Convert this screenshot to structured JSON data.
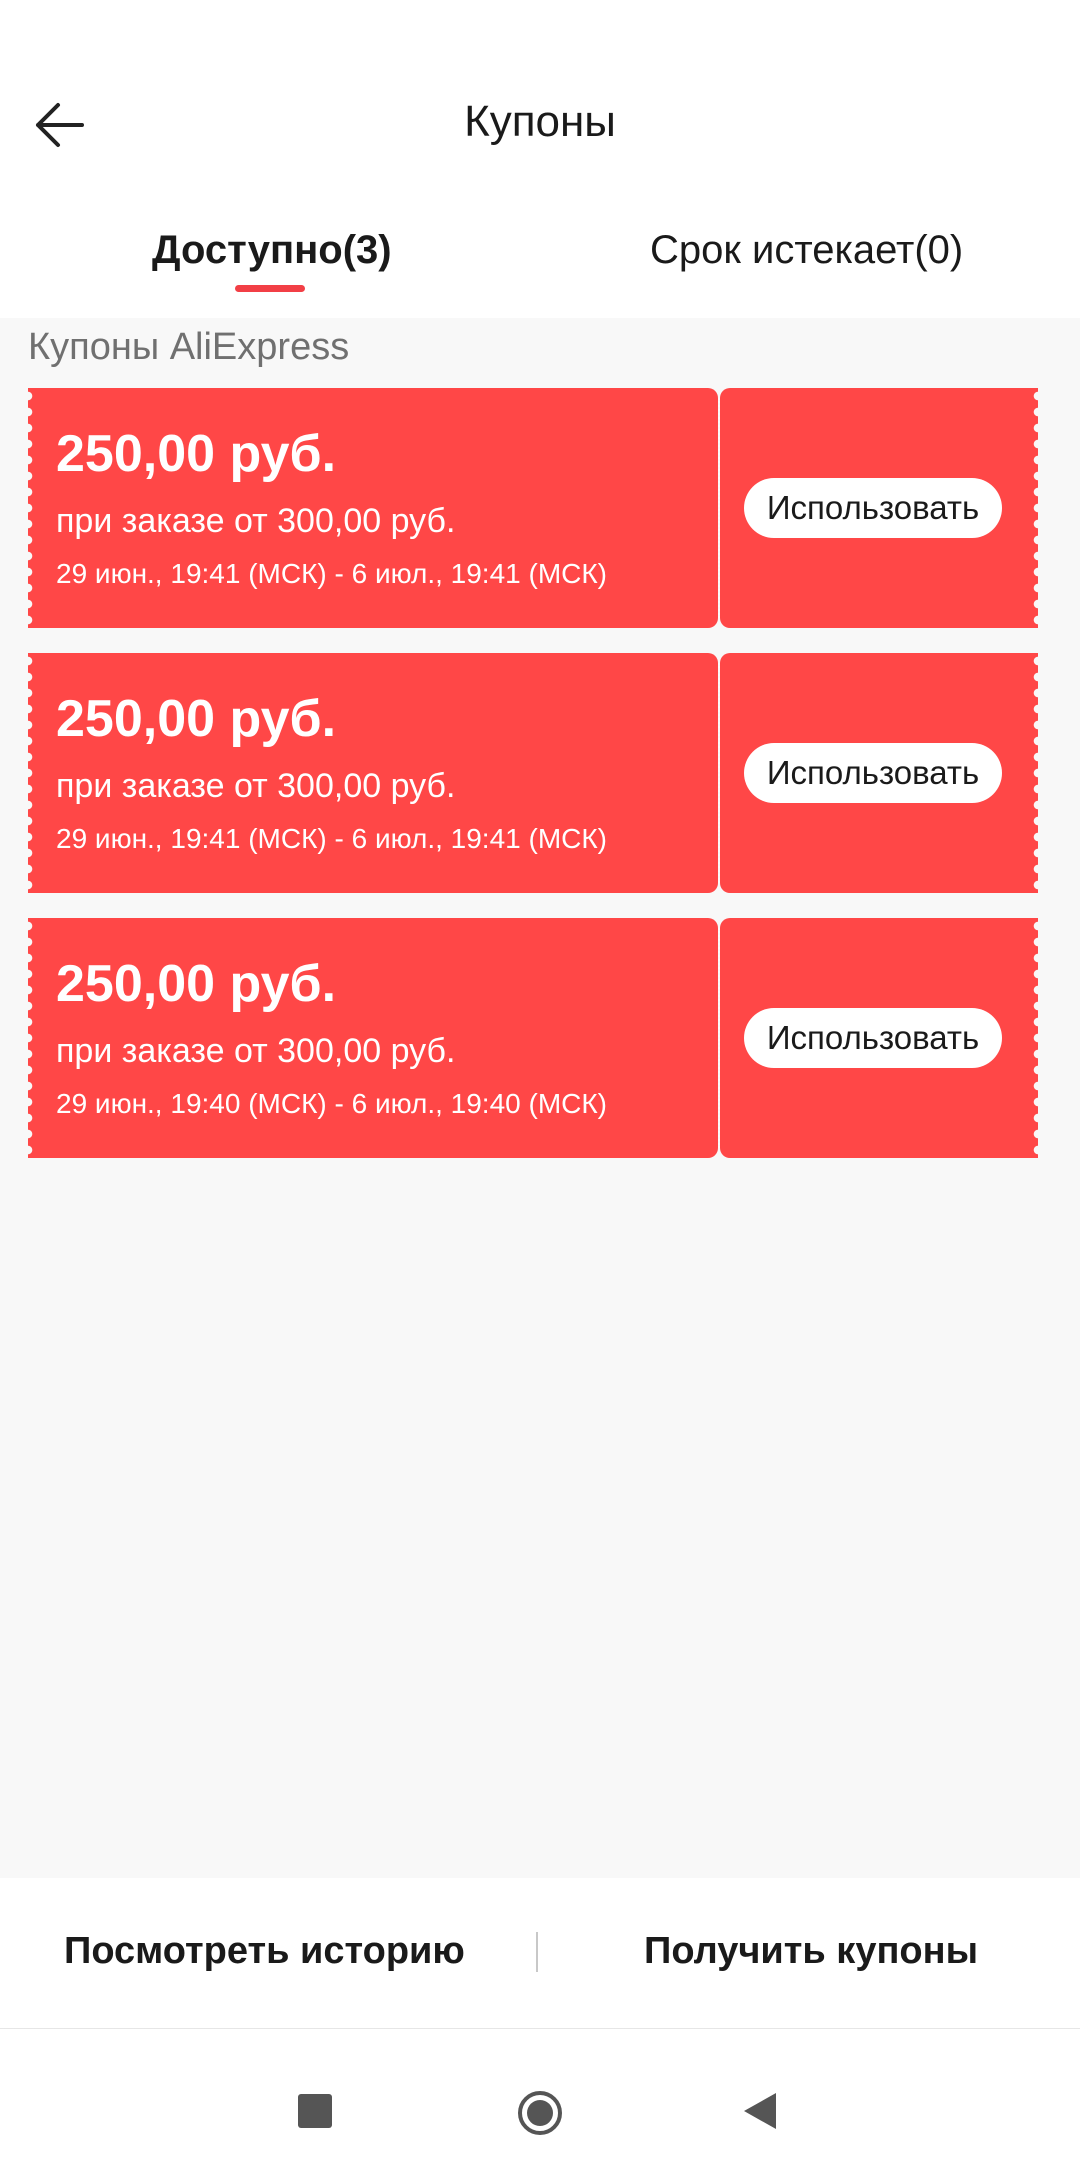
{
  "header": {
    "title": "Купоны"
  },
  "tabs": [
    {
      "label": "Доступно(3)",
      "active": true
    },
    {
      "label": "Срок истекает(0)",
      "active": false
    }
  ],
  "section": {
    "title": "Купоны AliExpress"
  },
  "coupons": [
    {
      "amount": "250,00 руб.",
      "condition": "при заказе от 300,00 руб.",
      "period": "29 июн., 19:41 (МСК) - 6 июл., 19:41 (МСК)",
      "button": "Использовать"
    },
    {
      "amount": "250,00 руб.",
      "condition": "при заказе от 300,00 руб.",
      "period": "29 июн., 19:41 (МСК) - 6 июл., 19:41 (МСК)",
      "button": "Использовать"
    },
    {
      "amount": "250,00 руб.",
      "condition": "при заказе от 300,00 руб.",
      "period": "29 июн., 19:40 (МСК) - 6 июл., 19:40 (МСК)",
      "button": "Использовать"
    }
  ],
  "footer": {
    "history_label": "Посмотреть историю",
    "get_coupons_label": "Получить купоны"
  },
  "colors": {
    "coupon": "#ff4747",
    "accent": "#f23f46",
    "background": "#f8f8f8"
  },
  "icons": {
    "back": "arrow-left-icon",
    "nav_recent": "square-icon",
    "nav_home": "circle-icon",
    "nav_back": "triangle-left-icon"
  }
}
